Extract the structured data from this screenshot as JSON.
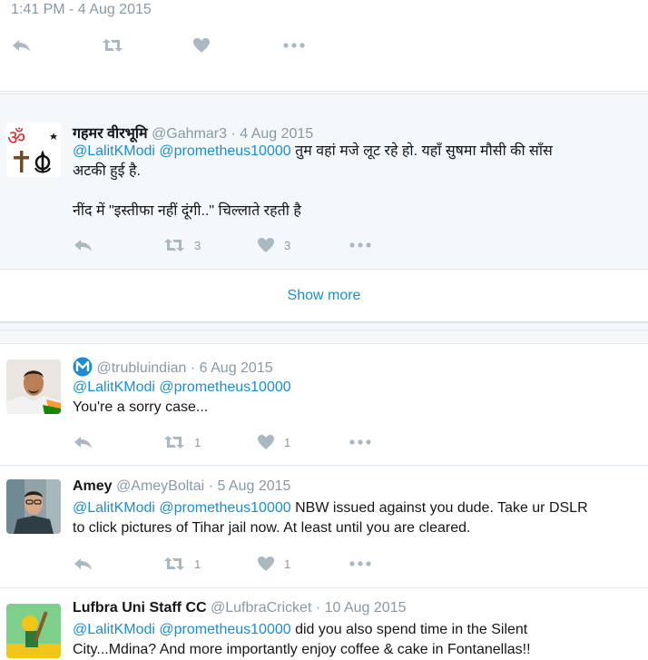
{
  "top_tweet": {
    "timestamp": "1:41 PM - 4 Aug 2015"
  },
  "replies_a": [
    {
      "name": "गहमर वीरभूमि",
      "handle": "@Gahmar3",
      "sep": "·",
      "date": "4 Aug 2015",
      "mentions": [
        "@LalitKModi",
        "@prometheus10000"
      ],
      "text_line1": "तुम वहां मजे लूट रहे हो. यहाँ सुषमा मौसी की साँस",
      "text_line2": "अटकी हुई है.",
      "text_line3": "नींद में \"इस्तीफा नहीं दूंगी..\" चिल्लाते रहती है",
      "retweets": "3",
      "likes": "3",
      "avatar_icon": "religious-symbols-icon"
    }
  ],
  "show_more": "Show more",
  "replies_b": [
    {
      "name": "",
      "handle": "@trubluindian",
      "sep": "·",
      "date": "6 Aug 2015",
      "mentions": [
        "@LalitKModi",
        "@prometheus10000"
      ],
      "text_line1": "You're a sorry case...",
      "retweets": "1",
      "likes": "1",
      "badge_icon": "m-logo-icon"
    },
    {
      "name": "Amey",
      "handle": "@AmeyBoltai",
      "sep": "·",
      "date": "5 Aug 2015",
      "mentions": [
        "@LalitKModi",
        "@prometheus10000"
      ],
      "text_line1": "NBW issued against you dude. Take ur DSLR",
      "text_line2": "to click pictures of Tihar jail now. At least until you are cleared.",
      "retweets": "1",
      "likes": "1"
    },
    {
      "name": "Lufbra Uni Staff CC",
      "handle": "@LufbraCricket",
      "sep": "·",
      "date": "10 Aug 2015",
      "mentions": [
        "@LalitKModi",
        "@prometheus10000"
      ],
      "text_line1": "did you also spend time in the Silent",
      "text_line2": "City...Mdina? And more importantly enjoy coffee & cake in Fontanellas!!"
    }
  ],
  "colors": {
    "link": "#1b8ecf",
    "muted": "#8899a6",
    "icon": "#aab8c2",
    "band": "#f5f8fa"
  }
}
